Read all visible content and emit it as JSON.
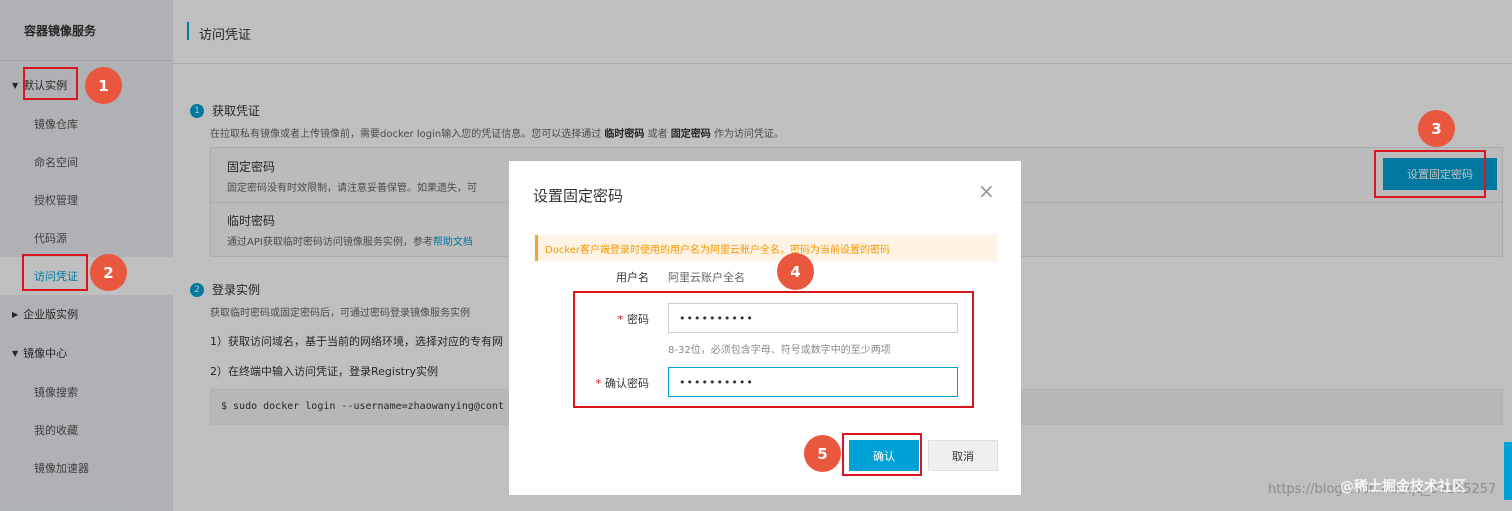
{
  "sidebar": {
    "title": "容器镜像服务",
    "group_default": "默认实例",
    "items": [
      "镜像仓库",
      "命名空间",
      "授权管理",
      "代码源",
      "访问凭证"
    ],
    "group_enterprise": "企业版实例",
    "group_mirror": "镜像中心",
    "mirror_items": [
      "镜像搜索",
      "我的收藏",
      "镜像加速器"
    ]
  },
  "header": {
    "title": "访问凭证"
  },
  "main": {
    "step1": {
      "num": "1",
      "title": "获取凭证"
    },
    "step1_desc_a": "在拉取私有镜像或者上传镜像前，需要docker login输入您的凭证信息。您可以选择通过 ",
    "step1_desc_b": "临时密码",
    "step1_desc_c": " 或者 ",
    "step1_desc_d": "固定密码",
    "step1_desc_e": " 作为访问凭证。",
    "fixed_title": "固定密码",
    "fixed_sub": "固定密码没有时效限制，请注意妥善保管。如果遗失，可",
    "temp_title": "临时密码",
    "temp_sub": "通过API获取临时密码访问镜像服务实例，参考",
    "temp_link": "帮助文档",
    "set_pwd_button": "设置固定密码",
    "step2": {
      "num": "2",
      "title": "登录实例"
    },
    "step2_desc": "获取临时密码或固定密码后，可通过密码登录镜像服务实例",
    "step2_line1": "1）获取访问域名，基于当前的网络环境，选择对应的专有网",
    "step2_line2": "2）在终端中输入访问凭证，登录Registry实例",
    "code": "$ sudo docker login --username=zhaowanying@cont"
  },
  "modal": {
    "title": "设置固定密码",
    "close": "×",
    "alert": "Docker客户端登录时使用的用户名为阿里云账户全名，密码为当前设置的密码",
    "username_label": "用户名",
    "username_value": "阿里云账户全名",
    "required_mark": "*",
    "password_label": "密码",
    "password_value": "••••••••••",
    "password_hint": "8-32位，必须包含字母、符号或数字中的至少两项",
    "confirm_label": "确认密码",
    "confirm_value": "••••••••••",
    "ok_button": "确认",
    "cancel_button": "取消"
  },
  "annotations": [
    "1",
    "2",
    "3",
    "4",
    "5"
  ],
  "watermark": "https://blog.csdn.net/qq_39185257",
  "watermark2": "@稀土掘金技术社区",
  "colors": {
    "accent": "#00a1d6",
    "annotation": "#e9573f",
    "highlight": "#d9161e",
    "alert": "#f39800"
  }
}
